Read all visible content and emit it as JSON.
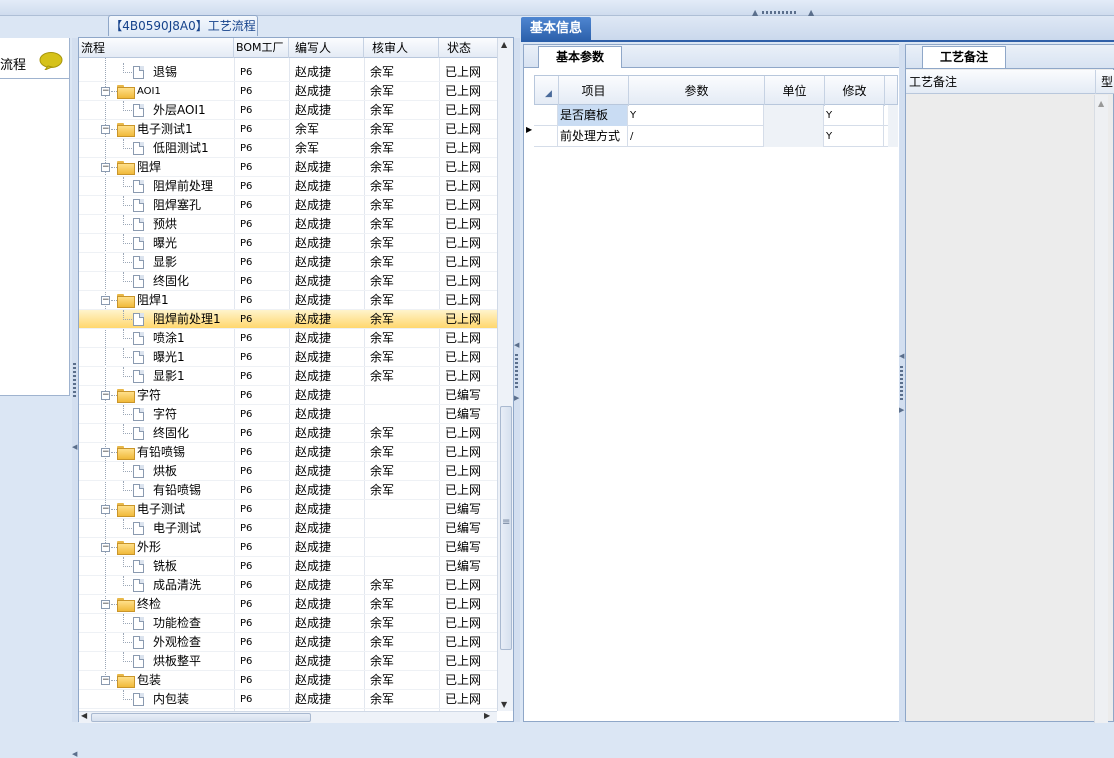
{
  "top_tab": "【4B0590J8A0】工艺流程",
  "left_panel": {
    "label": "流程",
    "chat_icon": "speech-bubble-icon"
  },
  "grid": {
    "columns": [
      "流程",
      "BOM工厂",
      "编写人",
      "核审人",
      "状态"
    ],
    "rows": [
      {
        "name": "退锡",
        "level": 2,
        "folder": false,
        "bom": "P6",
        "writer": "赵成捷",
        "reviewer": "余军",
        "status": "已上网"
      },
      {
        "name": "AOI1",
        "level": 1,
        "folder": true,
        "bom": "P6",
        "writer": "赵成捷",
        "reviewer": "余军",
        "status": "已上网"
      },
      {
        "name": "外层AOI1",
        "level": 2,
        "folder": false,
        "bom": "P6",
        "writer": "赵成捷",
        "reviewer": "余军",
        "status": "已上网"
      },
      {
        "name": "电子测试1",
        "level": 1,
        "folder": true,
        "bom": "P6",
        "writer": "余军",
        "reviewer": "余军",
        "status": "已上网"
      },
      {
        "name": "低阻测试1",
        "level": 2,
        "folder": false,
        "bom": "P6",
        "writer": "余军",
        "reviewer": "余军",
        "status": "已上网"
      },
      {
        "name": "阻焊",
        "level": 1,
        "folder": true,
        "bom": "P6",
        "writer": "赵成捷",
        "reviewer": "余军",
        "status": "已上网"
      },
      {
        "name": "阻焊前处理",
        "level": 2,
        "folder": false,
        "bom": "P6",
        "writer": "赵成捷",
        "reviewer": "余军",
        "status": "已上网"
      },
      {
        "name": "阻焊塞孔",
        "level": 2,
        "folder": false,
        "bom": "P6",
        "writer": "赵成捷",
        "reviewer": "余军",
        "status": "已上网"
      },
      {
        "name": "预烘",
        "level": 2,
        "folder": false,
        "bom": "P6",
        "writer": "赵成捷",
        "reviewer": "余军",
        "status": "已上网"
      },
      {
        "name": "曝光",
        "level": 2,
        "folder": false,
        "bom": "P6",
        "writer": "赵成捷",
        "reviewer": "余军",
        "status": "已上网"
      },
      {
        "name": "显影",
        "level": 2,
        "folder": false,
        "bom": "P6",
        "writer": "赵成捷",
        "reviewer": "余军",
        "status": "已上网"
      },
      {
        "name": "终固化",
        "level": 2,
        "folder": false,
        "bom": "P6",
        "writer": "赵成捷",
        "reviewer": "余军",
        "status": "已上网"
      },
      {
        "name": "阻焊1",
        "level": 1,
        "folder": true,
        "bom": "P6",
        "writer": "赵成捷",
        "reviewer": "余军",
        "status": "已上网"
      },
      {
        "name": "阻焊前处理1",
        "level": 2,
        "folder": false,
        "bom": "P6",
        "writer": "赵成捷",
        "reviewer": "余军",
        "status": "已上网",
        "selected": true
      },
      {
        "name": "喷涂1",
        "level": 2,
        "folder": false,
        "bom": "P6",
        "writer": "赵成捷",
        "reviewer": "余军",
        "status": "已上网"
      },
      {
        "name": "曝光1",
        "level": 2,
        "folder": false,
        "bom": "P6",
        "writer": "赵成捷",
        "reviewer": "余军",
        "status": "已上网"
      },
      {
        "name": "显影1",
        "level": 2,
        "folder": false,
        "bom": "P6",
        "writer": "赵成捷",
        "reviewer": "余军",
        "status": "已上网"
      },
      {
        "name": "字符",
        "level": 1,
        "folder": true,
        "bom": "P6",
        "writer": "赵成捷",
        "reviewer": "",
        "status": "已编写"
      },
      {
        "name": "字符",
        "level": 2,
        "folder": false,
        "bom": "P6",
        "writer": "赵成捷",
        "reviewer": "",
        "status": "已编写"
      },
      {
        "name": "终固化",
        "level": 2,
        "folder": false,
        "bom": "P6",
        "writer": "赵成捷",
        "reviewer": "余军",
        "status": "已上网"
      },
      {
        "name": "有铅喷锡",
        "level": 1,
        "folder": true,
        "bom": "P6",
        "writer": "赵成捷",
        "reviewer": "余军",
        "status": "已上网"
      },
      {
        "name": "烘板",
        "level": 2,
        "folder": false,
        "bom": "P6",
        "writer": "赵成捷",
        "reviewer": "余军",
        "status": "已上网"
      },
      {
        "name": "有铅喷锡",
        "level": 2,
        "folder": false,
        "bom": "P6",
        "writer": "赵成捷",
        "reviewer": "余军",
        "status": "已上网"
      },
      {
        "name": "电子测试",
        "level": 1,
        "folder": true,
        "bom": "P6",
        "writer": "赵成捷",
        "reviewer": "",
        "status": "已编写"
      },
      {
        "name": "电子测试",
        "level": 2,
        "folder": false,
        "bom": "P6",
        "writer": "赵成捷",
        "reviewer": "",
        "status": "已编写"
      },
      {
        "name": "外形",
        "level": 1,
        "folder": true,
        "bom": "P6",
        "writer": "赵成捷",
        "reviewer": "",
        "status": "已编写"
      },
      {
        "name": "铣板",
        "level": 2,
        "folder": false,
        "bom": "P6",
        "writer": "赵成捷",
        "reviewer": "",
        "status": "已编写"
      },
      {
        "name": "成品清洗",
        "level": 2,
        "folder": false,
        "bom": "P6",
        "writer": "赵成捷",
        "reviewer": "余军",
        "status": "已上网"
      },
      {
        "name": "终检",
        "level": 1,
        "folder": true,
        "bom": "P6",
        "writer": "赵成捷",
        "reviewer": "余军",
        "status": "已上网"
      },
      {
        "name": "功能检查",
        "level": 2,
        "folder": false,
        "bom": "P6",
        "writer": "赵成捷",
        "reviewer": "余军",
        "status": "已上网"
      },
      {
        "name": "外观检查",
        "level": 2,
        "folder": false,
        "bom": "P6",
        "writer": "赵成捷",
        "reviewer": "余军",
        "status": "已上网"
      },
      {
        "name": "烘板整平",
        "level": 2,
        "folder": false,
        "bom": "P6",
        "writer": "赵成捷",
        "reviewer": "余军",
        "status": "已上网"
      },
      {
        "name": "包装",
        "level": 1,
        "folder": true,
        "bom": "P6",
        "writer": "赵成捷",
        "reviewer": "余军",
        "status": "已上网"
      },
      {
        "name": "内包装",
        "level": 2,
        "folder": false,
        "bom": "P6",
        "writer": "赵成捷",
        "reviewer": "余军",
        "status": "已上网"
      }
    ]
  },
  "right": {
    "main_tab": "基本信息",
    "param_tab": "基本参数",
    "param_columns": [
      "项目",
      "参数",
      "单位",
      "修改"
    ],
    "params": [
      {
        "item": "是否磨板",
        "value": "Y",
        "unit": "",
        "modify": "Y"
      },
      {
        "item": "前处理方式",
        "value": "/",
        "unit": "",
        "modify": "Y"
      }
    ],
    "note_tab": "工艺备注",
    "note_columns": [
      "工艺备注",
      "型"
    ]
  },
  "colors": {
    "accent": "#2a5ea9",
    "selected_row": "#ffd76e",
    "panel_bg": "#dbe6f4"
  }
}
